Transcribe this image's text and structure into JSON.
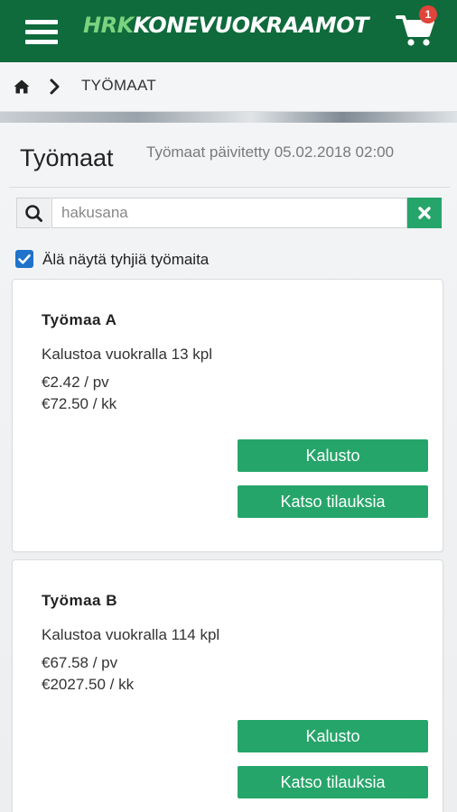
{
  "header": {
    "brand_part1": "HRK",
    "brand_part2": "KONEVUOKRAAMOT",
    "cart_count": "1",
    "brand_color": "#0f6a3c",
    "accent_color": "#26a56a",
    "icons": [
      "menu-icon",
      "cart-icon"
    ]
  },
  "breadcrumb": {
    "current": "TYÖMAAT",
    "icons": [
      "home-icon",
      "chevron-right-icon"
    ]
  },
  "page": {
    "title": "Työmaat",
    "updated": "Työmaat päivitetty 05.02.2018 02:00"
  },
  "search": {
    "placeholder": "hakusana",
    "value": ""
  },
  "filter": {
    "label": "Älä näytä tyhjiä työmaita",
    "checked": true
  },
  "sites": [
    {
      "name": "Työmaa A",
      "equipment": "Kalustoa vuokralla 13 kpl",
      "price_day": "€2.42 / pv",
      "price_month": "€72.50 / kk",
      "button_equipment": "Kalusto",
      "button_orders": "Katso tilauksia"
    },
    {
      "name": "Työmaa B",
      "equipment": "Kalustoa vuokralla 114 kpl",
      "price_day": "€67.58 / pv",
      "price_month": "€2027.50 / kk",
      "button_equipment": "Kalusto",
      "button_orders": "Katso tilauksia"
    }
  ]
}
